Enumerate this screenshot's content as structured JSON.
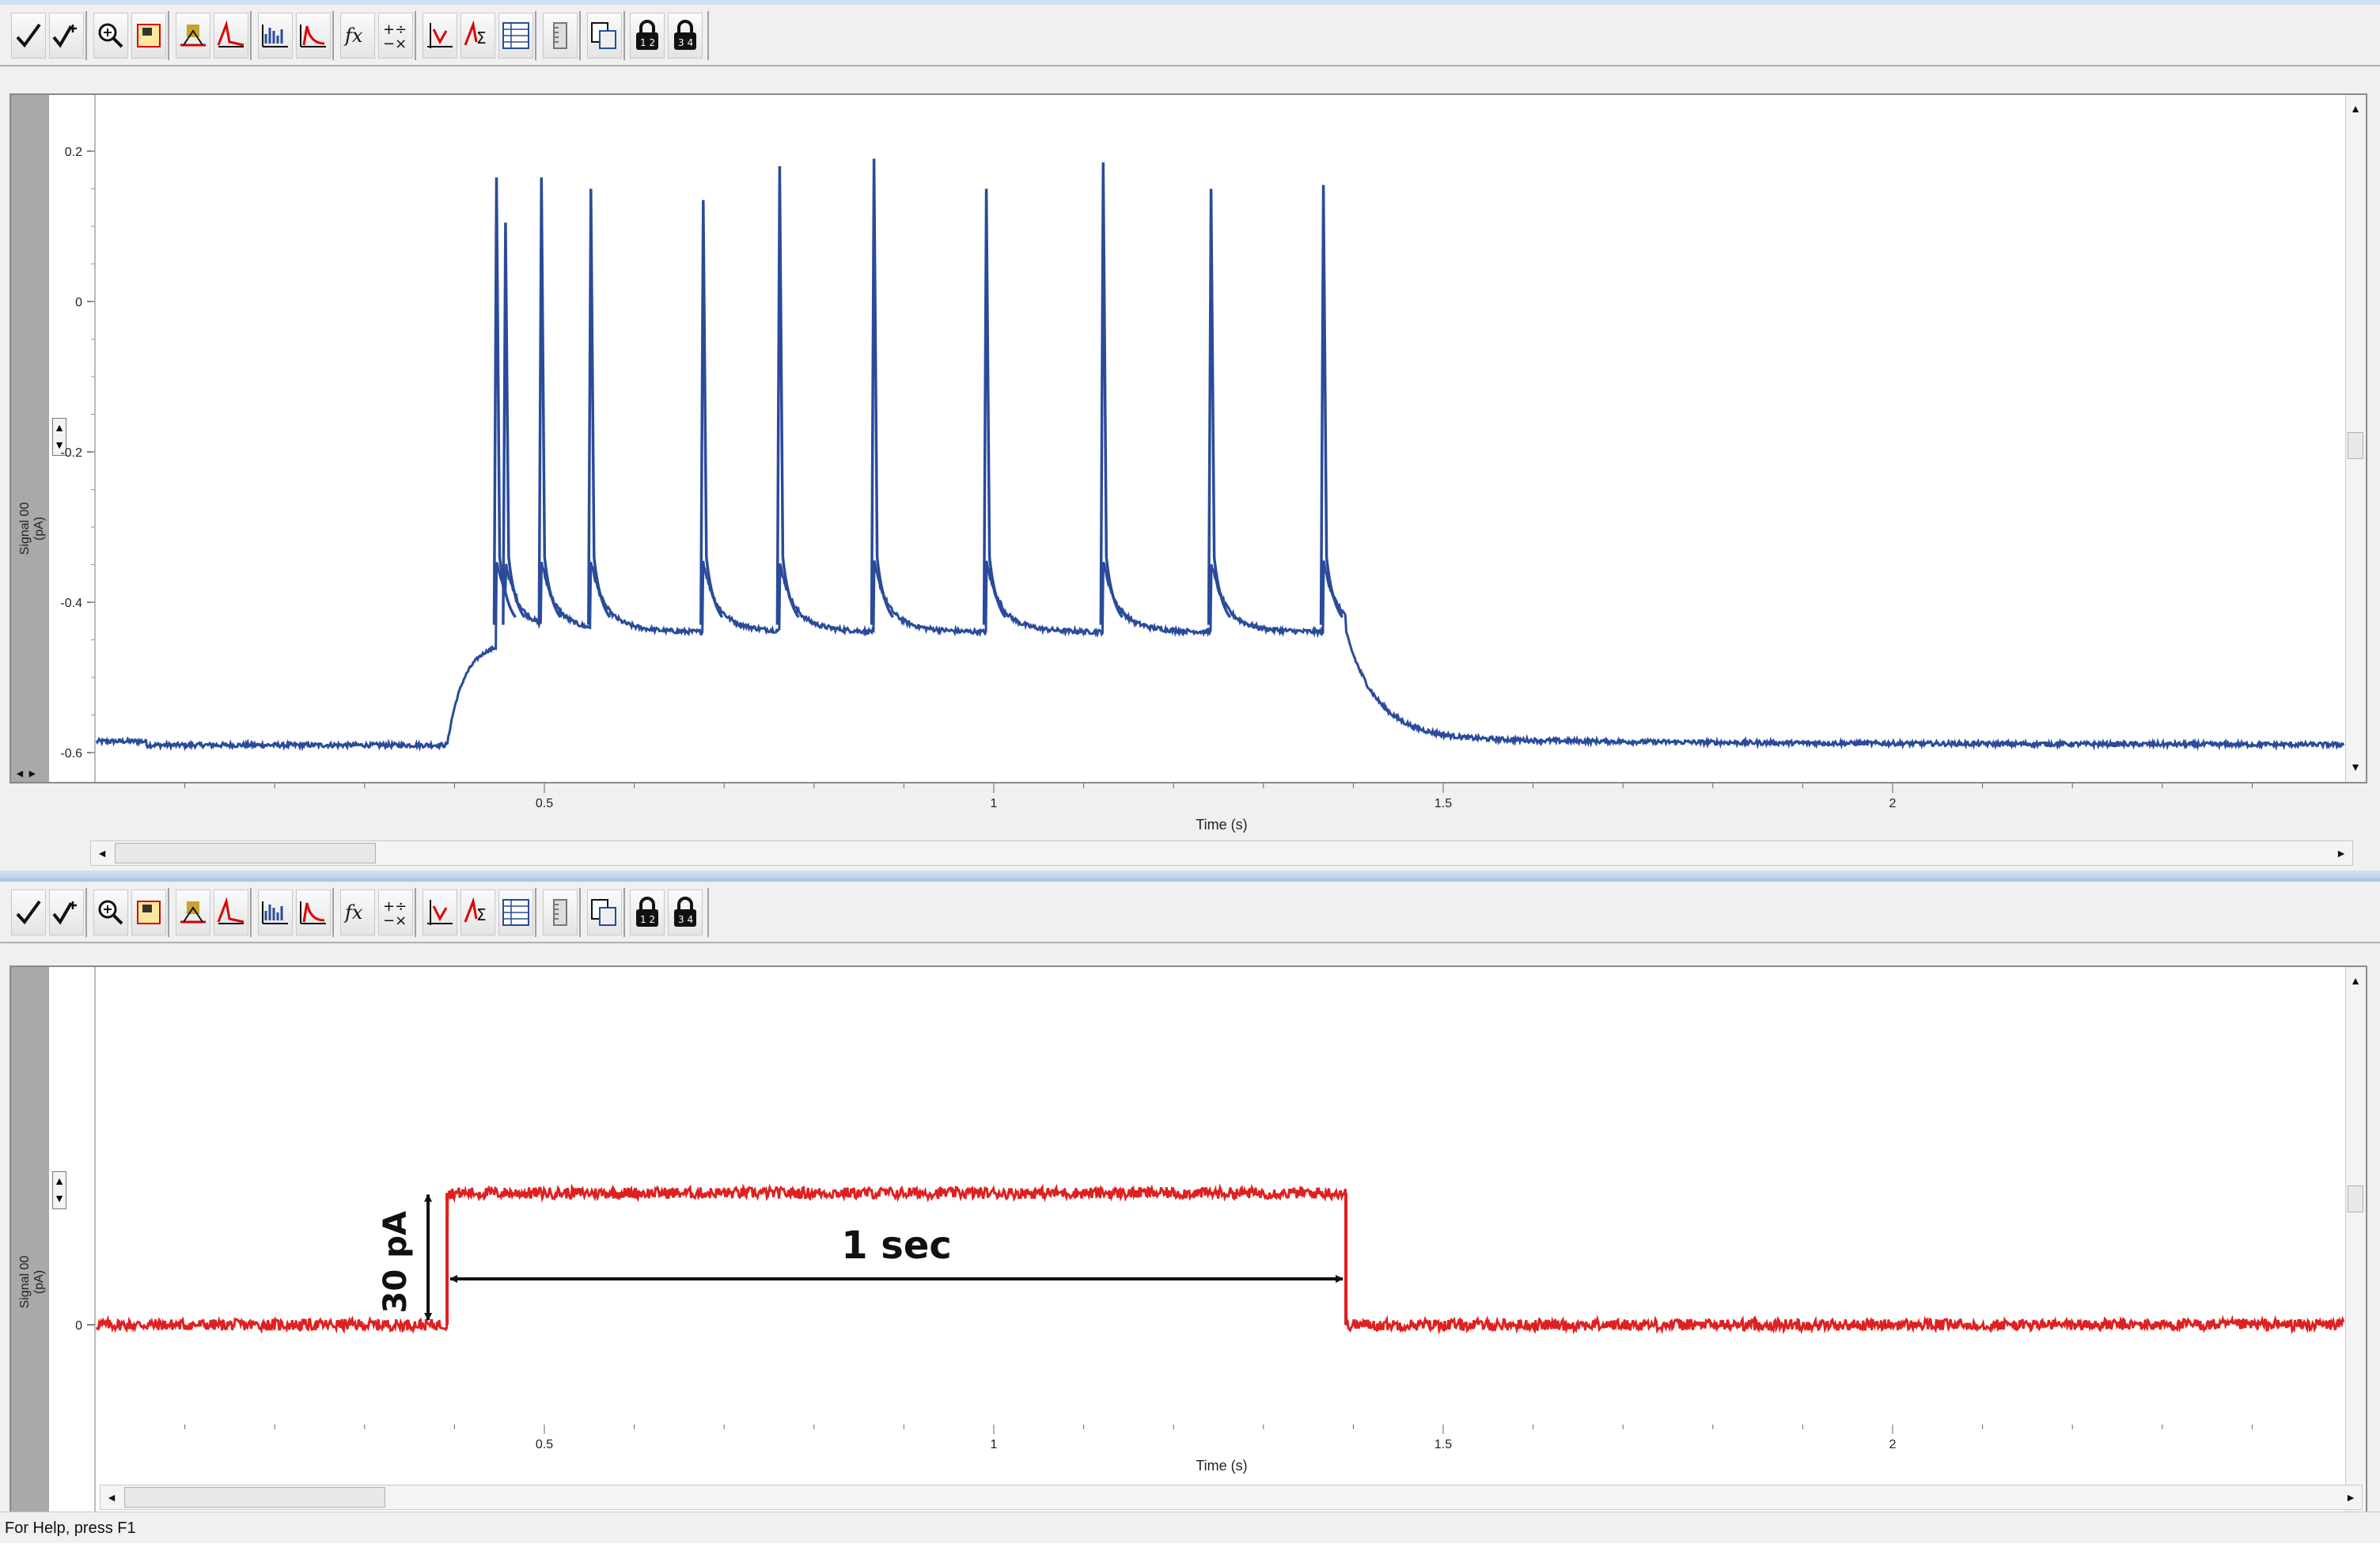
{
  "toolbar": {
    "buttons": [
      {
        "icon": "check-icon",
        "name": "accept-button"
      },
      {
        "icon": "check-plus-icon",
        "name": "accept-all-button"
      },
      {
        "icon": "zoom-in-icon",
        "name": "zoom-button"
      },
      {
        "icon": "fit-region-icon",
        "name": "fit-region-button"
      },
      {
        "icon": "baseline-icon",
        "name": "baseline-button"
      },
      {
        "icon": "peak-icon",
        "name": "peak-button"
      },
      {
        "icon": "histogram-icon",
        "name": "histogram-button"
      },
      {
        "icon": "decay-icon",
        "name": "decay-button"
      },
      {
        "icon": "function-icon",
        "name": "function-button"
      },
      {
        "icon": "arithmetic-icon",
        "name": "arithmetic-button"
      },
      {
        "icon": "cursor-analysis-icon",
        "name": "cursor-analysis-button"
      },
      {
        "icon": "sum-icon",
        "name": "sum-button"
      },
      {
        "icon": "table-icon",
        "name": "table-button"
      },
      {
        "icon": "ruler-icon",
        "name": "ruler-button"
      },
      {
        "icon": "copy-icon",
        "name": "copy-button"
      },
      {
        "icon": "lock-12-icon",
        "name": "lock-12-button"
      },
      {
        "icon": "lock-34-icon",
        "name": "lock-34-button"
      }
    ]
  },
  "top_panel": {
    "ylabel_line1": "Signal 00",
    "ylabel_line2": "(pA)",
    "xlabel": "Time (s)",
    "x_ticks": [
      "0.5",
      "1",
      "1.5",
      "2"
    ],
    "y_ticks": [
      "0.2",
      "0",
      "-0.2",
      "-0.4",
      "-0.6"
    ],
    "color": "#2a4b9b"
  },
  "bottom_panel": {
    "ylabel_line1": "Signal 00",
    "ylabel_line2": "(pA)",
    "xlabel": "Time (s)",
    "x_ticks": [
      "0.5",
      "1",
      "1.5",
      "2"
    ],
    "y_ticks": [
      "0"
    ],
    "color": "#e02020",
    "annotation_amplitude": "30 pA",
    "annotation_duration": "1 sec"
  },
  "chart_data": [
    {
      "type": "line",
      "title": "",
      "xlabel": "Time (s)",
      "ylabel": "Signal 00 (pA)",
      "xlim": [
        0.0,
        2.5
      ],
      "ylim": [
        -0.62,
        0.22
      ],
      "grid": false,
      "series": [
        {
          "baseline": -0.59,
          "baseline_before_step": -0.585,
          "step_start": 0.39,
          "step_end": 1.39,
          "plateau_level": -0.44,
          "spike_times": [
            0.445,
            0.455,
            0.495,
            0.55,
            0.675,
            0.76,
            0.865,
            0.99,
            1.12,
            1.24,
            1.365
          ],
          "spike_peaks": [
            0.165,
            0.105,
            0.165,
            0.15,
            0.135,
            0.18,
            0.19,
            0.15,
            0.185,
            0.15,
            0.155
          ],
          "post_step_level": -0.58
        }
      ]
    },
    {
      "type": "line",
      "title": "",
      "xlabel": "Time (s)",
      "ylabel": "Signal 00 (pA)",
      "xlim": [
        0.0,
        2.5
      ],
      "grid": false,
      "series": [
        {
          "baseline": 0,
          "step_start": 0.39,
          "step_end": 1.39,
          "step_amplitude": 30
        }
      ]
    }
  ]
}
